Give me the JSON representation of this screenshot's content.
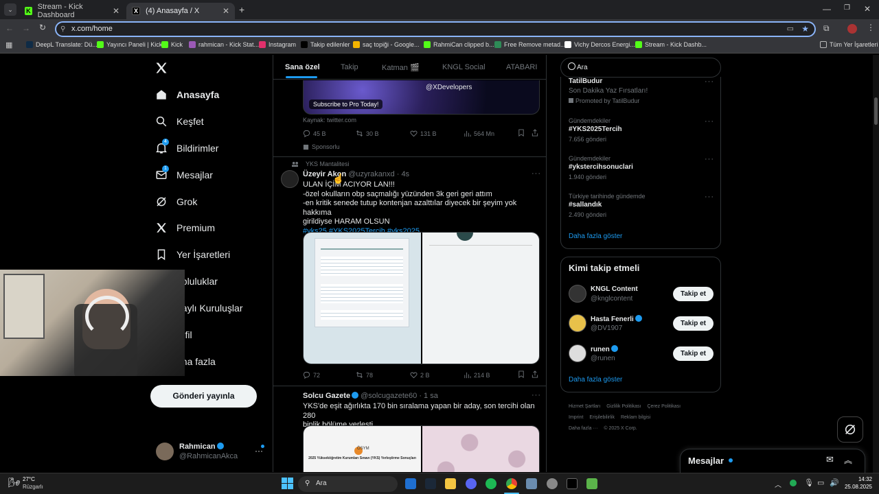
{
  "browser": {
    "tabs": [
      {
        "title": "Stream - Kick Dashboard",
        "icon": "kick-icon"
      },
      {
        "title": "(4) Anasayfa / X",
        "icon": "x-logo-icon"
      }
    ],
    "new_tab": "+",
    "url": "x.com/home",
    "bookmarks": [
      {
        "label": "DeepL Translate: Dü...",
        "color": "#0f2b46"
      },
      {
        "label": "Yayıncı Paneli | Kick",
        "color": "#53fc18"
      },
      {
        "label": "Kick",
        "color": "#53fc18"
      },
      {
        "label": "rahmican - Kick Stat...",
        "color": "#9b59b6"
      },
      {
        "label": "Instagram",
        "color": "#e1306c"
      },
      {
        "label": "Takip edilenler",
        "color": "#000000"
      },
      {
        "label": "saç topiği - Google...",
        "color": "#f4b400"
      },
      {
        "label": "RahmiCan clipped b...",
        "color": "#53fc18"
      },
      {
        "label": "Free Remove metad...",
        "color": "#2e8b57"
      },
      {
        "label": "Vichy Dercos Energi...",
        "color": "#ffffff"
      },
      {
        "label": "Stream - Kick Dashb...",
        "color": "#53fc18"
      }
    ],
    "all_bookmarks": "Tüm Yer İşaretleri"
  },
  "nav": {
    "items": [
      {
        "label": "Anasayfa",
        "icon": "home-icon"
      },
      {
        "label": "Keşfet",
        "icon": "search-icon"
      },
      {
        "label": "Bildirimler",
        "icon": "bell-icon",
        "badge": "4"
      },
      {
        "label": "Mesajlar",
        "icon": "mail-icon",
        "badge": "1"
      },
      {
        "label": "Grok",
        "icon": "grok-icon"
      },
      {
        "label": "Premium",
        "icon": "x-premium-icon"
      },
      {
        "label": "Yer İşaretleri",
        "icon": "bookmark-icon"
      },
      {
        "label": "opluluklar",
        "icon": "communities-icon"
      },
      {
        "label": "naylı Kuruluşlar",
        "icon": "verified-orgs-icon"
      },
      {
        "label": "rofil",
        "icon": "profile-icon"
      },
      {
        "label": "aha fazla",
        "icon": "more-icon"
      }
    ],
    "post_button": "Gönderi yayınla",
    "account": {
      "name": "Rahmican",
      "handle": "@RahmicanAkca"
    }
  },
  "feed": {
    "tabs": [
      "Sana özel",
      "Takip",
      "Katman 🎬",
      "KNGL Social",
      "ATABARI"
    ],
    "ad": {
      "banner_cta": "Subscribe to Pro Today!",
      "banner_handle": "@XDevelopers",
      "source": "Kaynak: twitter.com",
      "stats": {
        "replies": "45 B",
        "reposts": "30 B",
        "likes": "131 B",
        "views": "564 Mn"
      },
      "sponsored": "Sponsorlu"
    },
    "post1": {
      "context": "YKS Mantalitesi",
      "name": "Üzeyir Akon",
      "handle": "@uzyrakanxd",
      "time": "· 4s",
      "lines": [
        "ULAN İÇİM ACIYOR LAN!!!",
        "-özel okulların obp saçmalığı yüzünden 3k geri geri attım",
        "-en kritik senede tutup kontenjan azalttılar diyecek bir şeyim yok hakkıma",
        "girildiyse HARAM OLSUN"
      ],
      "hashtags": "#yks25 #YKS2025Tercih #yks2025",
      "stats": {
        "replies": "72",
        "reposts": "78",
        "likes": "2 B",
        "views": "214 B"
      }
    },
    "post2": {
      "name": "Solcu Gazete",
      "handle": "@solcugazete60",
      "time": "· 1 sa",
      "lines": [
        "YKS'de eşit ağırlıkta 170 bin sıralama yapan bir aday, son tercihi olan 280",
        "binlik bölüme yerleşti."
      ],
      "image_caption_logo": "ÖSYM",
      "image_caption": "2025 Yükseköğretim Kurumları Sınavı (YKS) Yerleştirme Sonuçları"
    }
  },
  "sidebar": {
    "search_placeholder": "Ara",
    "trends": [
      {
        "category": "",
        "title": "TatilBudur",
        "subtitle": "Son Dakika Yaz Fırsatları!",
        "meta": "Promoted by TatilBudur"
      },
      {
        "category": "Gündemdekiler",
        "title": "#YKS2025Tercih",
        "meta": "7.656 gönderi"
      },
      {
        "category": "Gündemdekiler",
        "title": "#ykstercihsonuclari",
        "meta": "1.940 gönderi"
      },
      {
        "category": "Türkiye tarihinde gündemde",
        "title": "#sallandık",
        "meta": "2.490 gönderi"
      }
    ],
    "show_more": "Daha fazla göster",
    "who_to_follow": {
      "title": "Kimi takip etmeli",
      "accounts": [
        {
          "name": "KNGL Content",
          "handle": "@knglcontent",
          "verified": false,
          "button": "Takip et"
        },
        {
          "name": "Hasta Fenerli",
          "handle": "@DV1907",
          "verified": true,
          "button": "Takip et"
        },
        {
          "name": "runen",
          "handle": "@runen",
          "verified": true,
          "button": "Takip et"
        }
      ],
      "show_more": "Daha fazla göster"
    },
    "footer": [
      "Hizmet Şartları",
      "Gizlilik Politikası",
      "Çerez Politikası",
      "Imprint",
      "Erişilebilirlik",
      "Reklam bilgisi",
      "Daha fazla ···",
      "© 2025 X Corp."
    ],
    "messages_drawer": "Mesajlar"
  },
  "taskbar": {
    "weather_temp": "27°C",
    "weather_desc": "Rüzgarlı",
    "search": "Ara",
    "time": "14:32",
    "date": "25.08.2025"
  }
}
